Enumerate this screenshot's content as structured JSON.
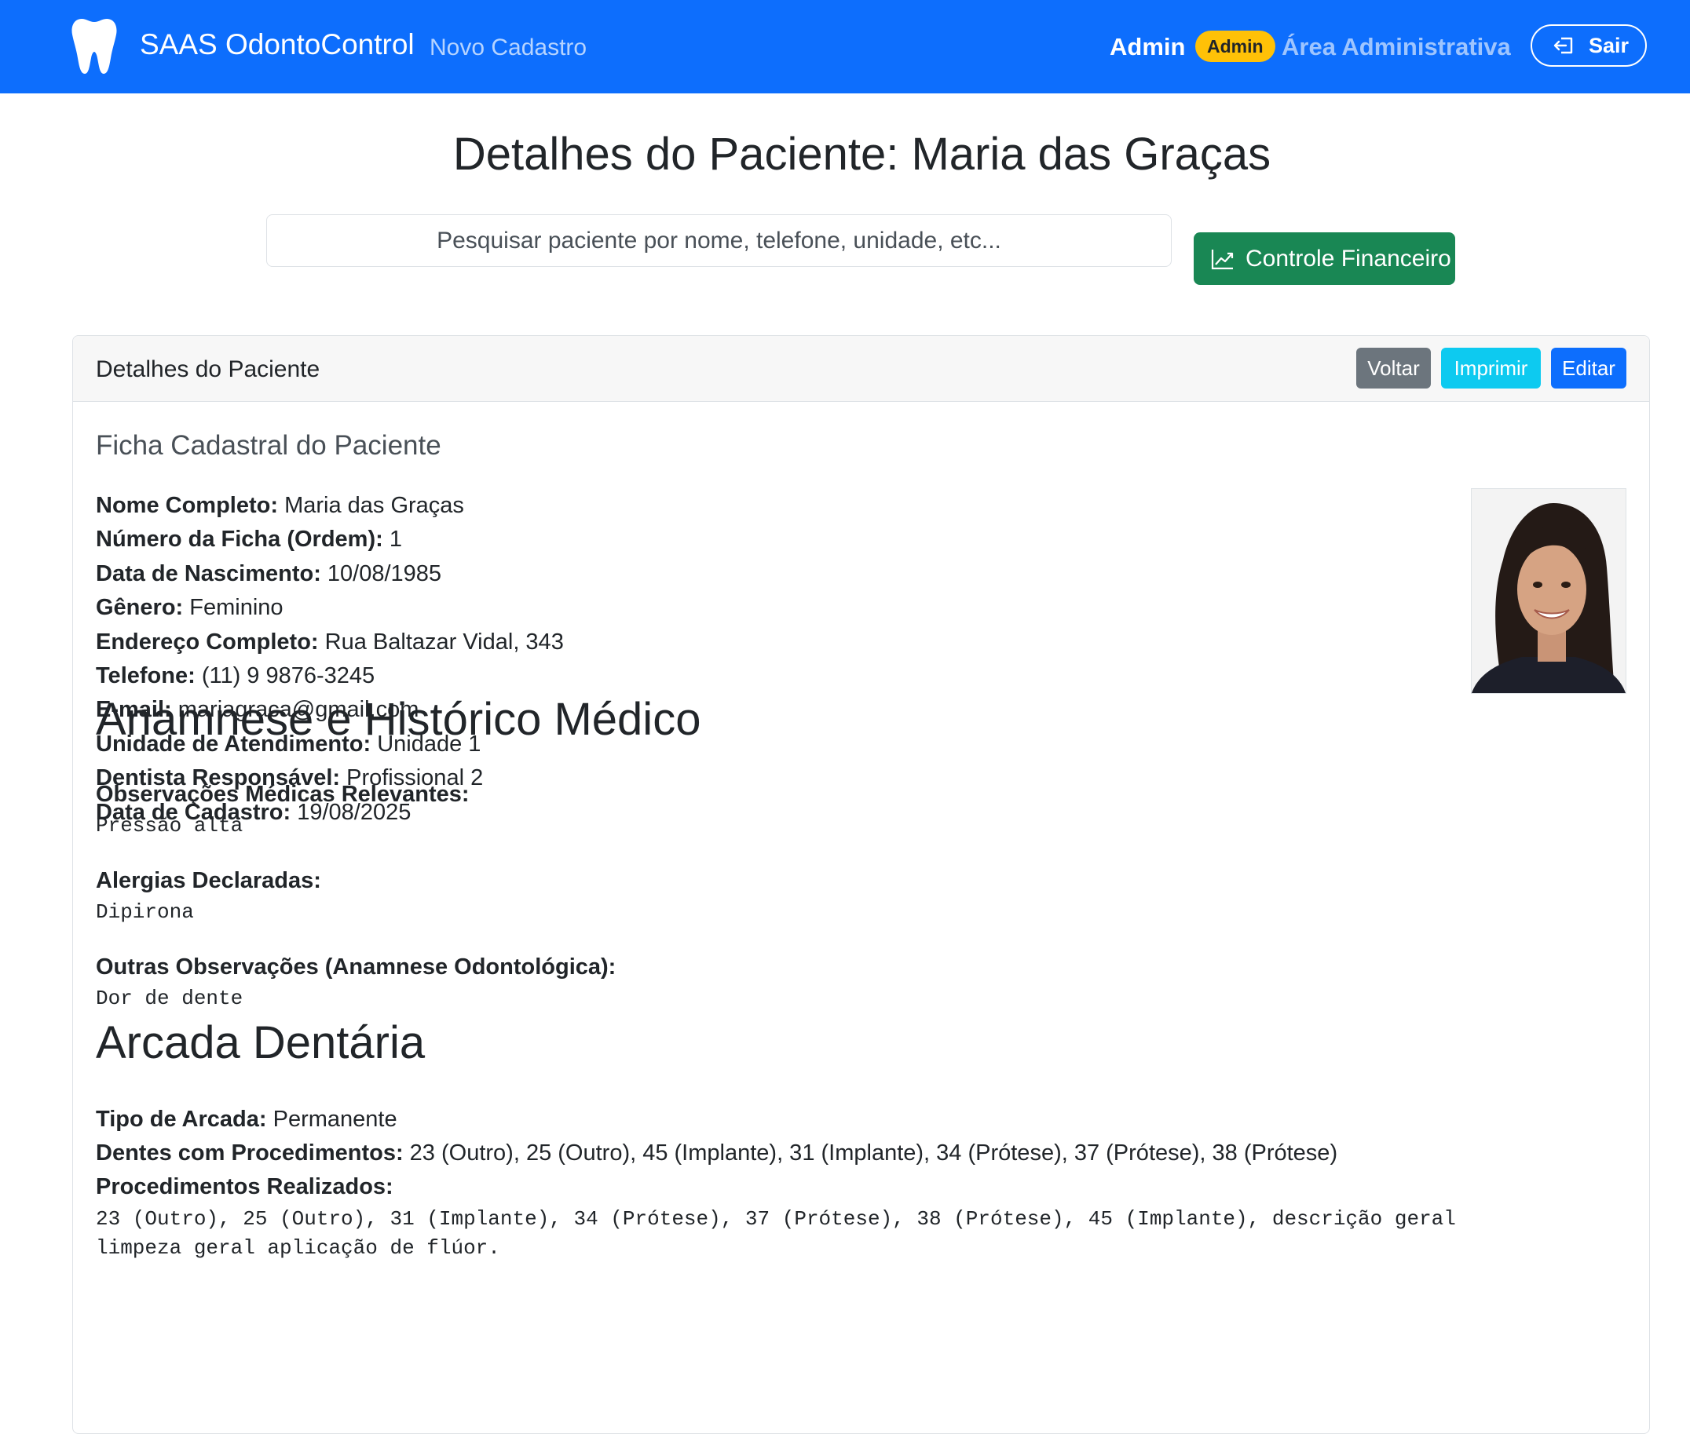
{
  "navbar": {
    "brand": "SAAS OdontoControl",
    "new_link": "Novo Cadastro",
    "user": "Admin",
    "badge": "Admin",
    "admin_area": "Área Administrativa",
    "logout": "Sair",
    "color": "#0d6efd"
  },
  "page": {
    "title": "Detalhes do Paciente: Maria das Graças",
    "search_placeholder": "Pesquisar paciente por nome, telefone, unidade, etc...",
    "finance_button": "Controle Financeiro"
  },
  "card": {
    "header_title": "Detalhes do Paciente",
    "buttons": {
      "back": "Voltar",
      "print": "Imprimir",
      "edit": "Editar"
    },
    "subtitle": "Ficha Cadastral do Paciente",
    "fields": [
      {
        "label": "Nome Completo:",
        "value": "Maria das Graças"
      },
      {
        "label": "Número da Ficha (Ordem):",
        "value": "1"
      },
      {
        "label": "Data de Nascimento:",
        "value": "10/08/1985"
      },
      {
        "label": "Gênero:",
        "value": "Feminino"
      },
      {
        "label": "Endereço Completo:",
        "value": "Rua Baltazar Vidal, 343"
      },
      {
        "label": "Telefone:",
        "value": "(11) 9 9876-3245"
      },
      {
        "label": "E-mail:",
        "value": "mariagraca@gmail.com"
      },
      {
        "label": "Unidade de Atendimento:",
        "value": "Unidade 1"
      },
      {
        "label": "Dentista Responsável:",
        "value": "Profissional 2"
      },
      {
        "label": "Data de Cadastro:",
        "value": "19/08/2025"
      }
    ],
    "anamnese": {
      "title": "Anamnese e Histórico Médico",
      "obs_label": "Observações Médicas Relevantes:",
      "obs_value": "Pressão alta",
      "allergy_label": "Alergias Declaradas:",
      "allergy_value": "Dipirona",
      "other_label": "Outras Observações (Anamnese Odontológica):",
      "other_value": "Dor de dente"
    },
    "arcada": {
      "title": "Arcada Dentária",
      "type_label": "Tipo de Arcada:",
      "type_value": "Permanente",
      "teeth_label": "Dentes com Procedimentos:",
      "teeth_value": "23 (Outro), 25 (Outro), 45 (Implante), 31 (Implante), 34 (Prótese), 37 (Prótese), 38 (Prótese)",
      "procedures_label": "Procedimentos Realizados:",
      "procedures_line1": "23 (Outro), 25 (Outro), 31 (Implante), 34 (Prótese), 37 (Prótese), 38 (Prótese), 45 (Implante), descrição geral",
      "procedures_line2": "limpeza geral aplicação de flúor."
    }
  }
}
